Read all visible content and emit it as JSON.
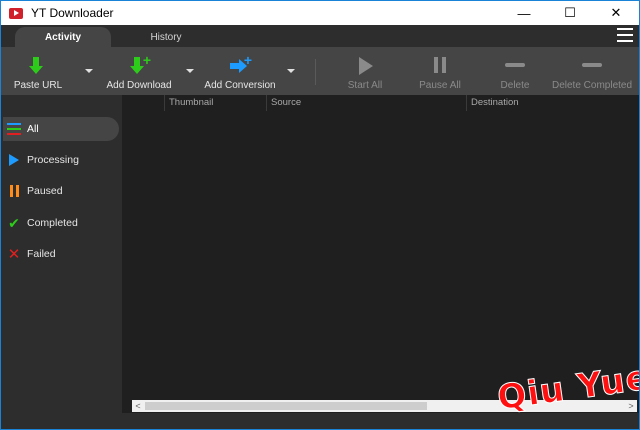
{
  "window": {
    "title": "YT Downloader",
    "minimize_label": "—",
    "maximize_label": "☐",
    "close_label": "✕"
  },
  "tabs": [
    {
      "label": "Activity",
      "active": true
    },
    {
      "label": "History",
      "active": false
    }
  ],
  "toolbar": {
    "paste_url": "Paste URL",
    "add_download": "Add Download",
    "add_conversion": "Add Conversion",
    "start_all": "Start All",
    "pause_all": "Pause All",
    "delete": "Delete",
    "delete_completed": "Delete Completed"
  },
  "sidebar": {
    "items": [
      {
        "label": "All",
        "icon": "list-icon",
        "active": true
      },
      {
        "label": "Processing",
        "icon": "play-icon",
        "active": false
      },
      {
        "label": "Paused",
        "icon": "pause-icon",
        "active": false
      },
      {
        "label": "Completed",
        "icon": "check-icon",
        "active": false
      },
      {
        "label": "Failed",
        "icon": "x-icon",
        "active": false
      }
    ]
  },
  "table": {
    "columns": [
      "Thumbnail",
      "Source",
      "Destination"
    ]
  },
  "scrollbar": {
    "left_arrow": "<",
    "right_arrow": ">"
  },
  "watermark": "Qiu Yue",
  "colors": {
    "accent_blue": "#1e9bff",
    "green": "#2ecc1a",
    "orange": "#ff8c1a",
    "red": "#e02020"
  }
}
